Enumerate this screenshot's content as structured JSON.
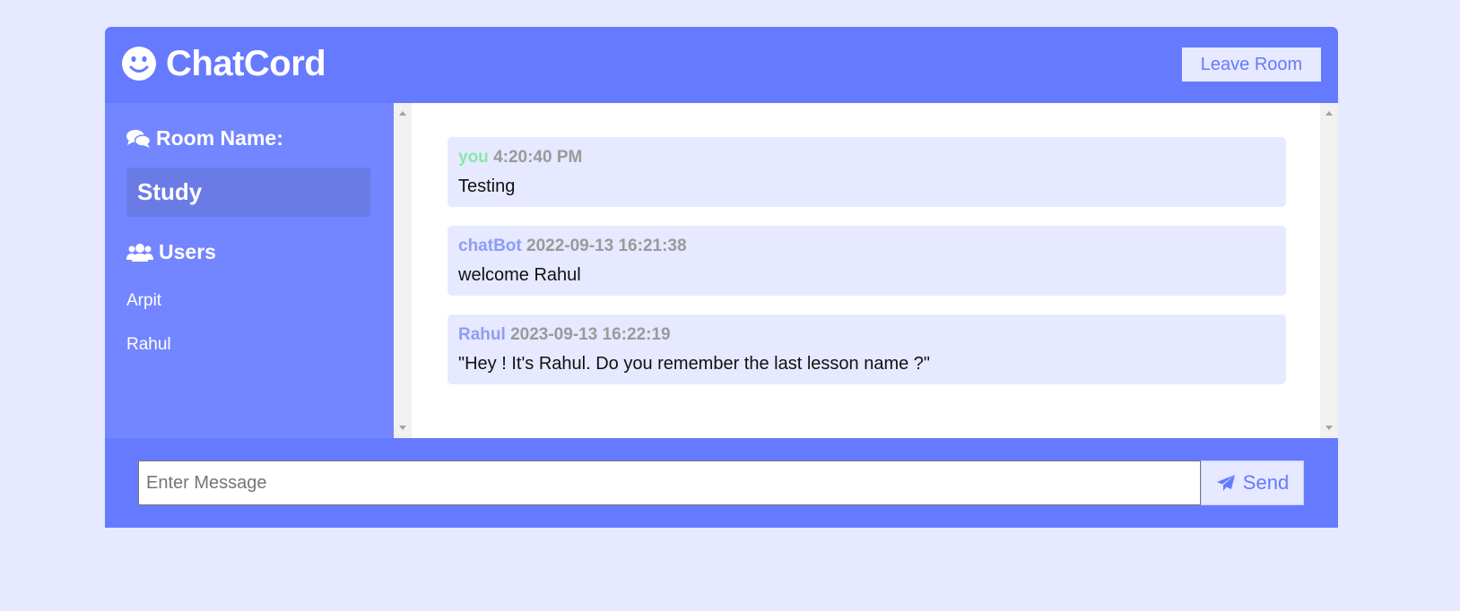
{
  "header": {
    "logo_icon": "smile-icon",
    "title": "ChatCord",
    "leave_label": "Leave Room"
  },
  "sidebar": {
    "room_heading": "Room Name:",
    "room_icon": "comments-icon",
    "room_name": "Study",
    "users_heading": "Users",
    "users_icon": "users-icon",
    "users": [
      "Arpit",
      "Rahul"
    ]
  },
  "messages": [
    {
      "user": "you",
      "time": "4:20:40 PM",
      "text": "Testing"
    },
    {
      "user": "chatBot",
      "time": "2022-09-13 16:21:38",
      "text": "welcome Rahul"
    },
    {
      "user": "Rahul",
      "time": "2023-09-13 16:22:19",
      "text": "\"Hey ! It's Rahul. Do you remember the last lesson name ?\""
    }
  ],
  "composer": {
    "placeholder": "Enter Message",
    "value": "",
    "send_label": "Send",
    "send_icon": "paper-plane-icon"
  },
  "colors": {
    "page_bg": "#e6e9ff",
    "primary": "#667aff",
    "sidebar_bg": "#7386ff",
    "room_box": "#6b7be6",
    "self_name": "#86e9a4",
    "other_name": "#8e9cf5",
    "time": "#9a9a9a"
  }
}
